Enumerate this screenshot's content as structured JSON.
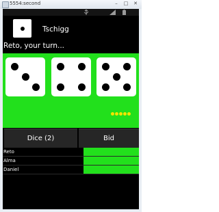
{
  "window": {
    "title": "5554:second",
    "min_label": "–",
    "max_label": "□",
    "close_label": "✕"
  },
  "status_bar": {
    "icons": [
      "usb-icon",
      "signal-icon",
      "battery-icon"
    ]
  },
  "app": {
    "title": "Tschigg",
    "turn_message": "Reto, your turn..."
  },
  "dice": [
    {
      "value": 3
    },
    {
      "value": 4
    },
    {
      "value": 5
    }
  ],
  "progress_dots": 5,
  "buttons": {
    "dice_label": "Dice (2)",
    "bid_label": "Bid"
  },
  "players": [
    {
      "name": "Reto"
    },
    {
      "name": "Alma"
    },
    {
      "name": "Daniel"
    }
  ],
  "colors": {
    "accent_green": "#22e01c",
    "dot_yellow": "#f3e400",
    "background": "#000000"
  }
}
